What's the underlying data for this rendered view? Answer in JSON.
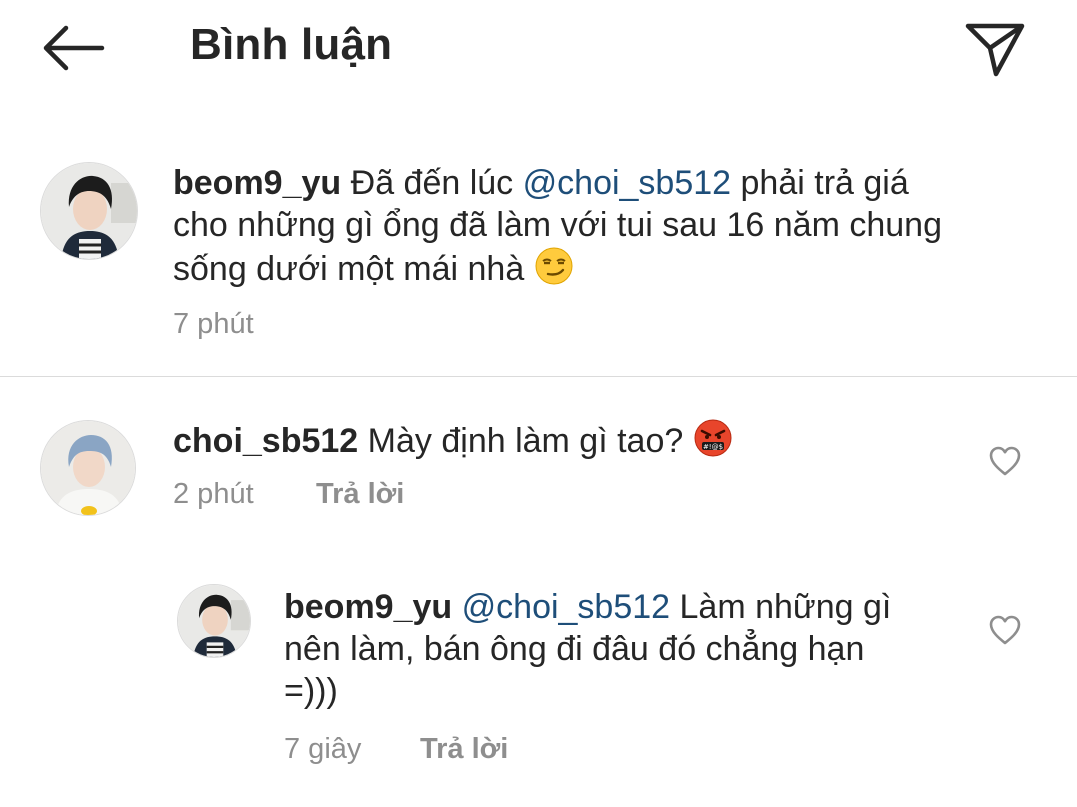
{
  "header": {
    "title": "Bình luận",
    "back_icon": "arrow-left-icon",
    "share_icon": "paper-plane-icon"
  },
  "caption": {
    "username": "beom9_yu",
    "text_before": "Đã đến lúc ",
    "mention": "@choi_sb512",
    "text_line1_after": " phải trả giá",
    "text_line2": "cho những gì ổng đã làm với tui sau 16 năm chung",
    "text_line3": "sống dưới một mái nhà ",
    "emoji": "smirk-emoji",
    "time": "7 phút"
  },
  "comments": [
    {
      "username": "choi_sb512",
      "text": "Mày định làm gì tao? ",
      "emoji": "angry-cursing-emoji",
      "time": "2 phút",
      "reply_label": "Trả lời",
      "like_icon": "heart-outline-icon"
    }
  ],
  "replies": [
    {
      "username": "beom9_yu",
      "mention": "@choi_sb512",
      "text_line1": " Làm những gì",
      "text_line2": "nên làm, bán ông đi đâu đó chẳng hạn",
      "text_line3": "=)))",
      "time": "7 giây",
      "reply_label": "Trả lời",
      "like_icon": "heart-outline-icon"
    }
  ],
  "colors": {
    "text": "#262626",
    "secondary": "#8e8e8e",
    "mention": "#1e4e79",
    "divider": "#dbdbdb"
  }
}
